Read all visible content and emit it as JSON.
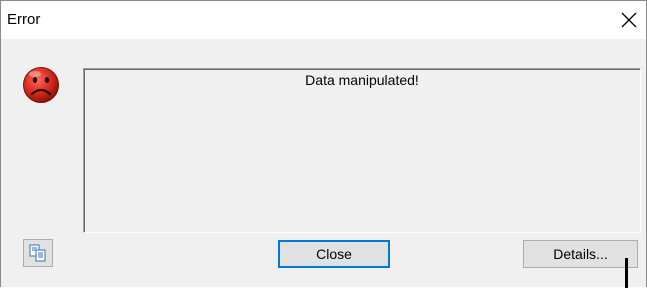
{
  "window": {
    "title": "Error"
  },
  "message": {
    "text": "Data manipulated!"
  },
  "buttons": {
    "close_label": "Close",
    "details_label": "Details..."
  },
  "icons": {
    "status": "sad-face-icon",
    "copy": "copy-to-clipboard-icon",
    "window_close": "close-icon"
  },
  "colors": {
    "sad_face": "#d62b1f",
    "default_button_border": "#0078d7"
  }
}
